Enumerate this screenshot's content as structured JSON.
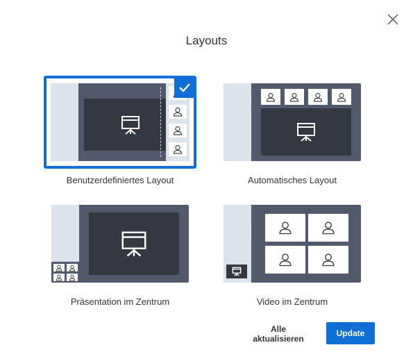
{
  "dialog": {
    "title": "Layouts",
    "close_icon": "close-icon"
  },
  "layouts": [
    {
      "label": "Benutzerdefiniertes Layout",
      "selected": true
    },
    {
      "label": "Automatisches Layout",
      "selected": false
    },
    {
      "label": "Präsentation im Zentrum",
      "selected": false
    },
    {
      "label": "Video im Zentrum",
      "selected": false
    }
  ],
  "footer": {
    "update_all_label": "Alle aktualisieren",
    "update_label": "Update"
  },
  "colors": {
    "accent": "#0e6fd4",
    "stage": "#51596a",
    "screen": "#343841",
    "sidebar": "#dde3ea"
  }
}
